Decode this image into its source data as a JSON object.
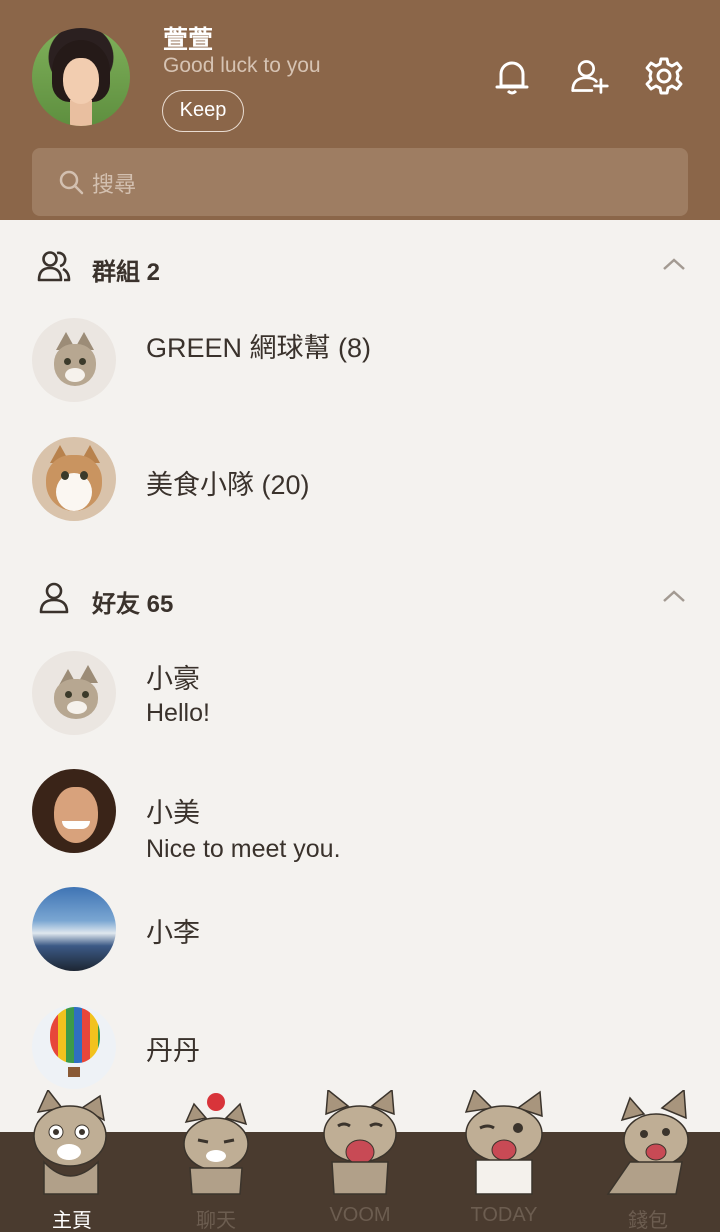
{
  "profile": {
    "name": "萱萱",
    "status": "Good luck to you",
    "keep_label": "Keep"
  },
  "header_icons": [
    "bell-icon",
    "add-friend-icon",
    "gear-icon"
  ],
  "search": {
    "placeholder": "搜尋",
    "icon": "search-icon"
  },
  "groups": {
    "title": "群組 2",
    "icon": "group-icon",
    "items": [
      {
        "name": "GREEN 網球幫 (8)"
      },
      {
        "name": "美食小隊 (20)"
      }
    ]
  },
  "friends": {
    "title": "好友 65",
    "icon": "person-icon",
    "items": [
      {
        "name": "小豪",
        "message": "Hello!"
      },
      {
        "name": "小美",
        "message": "Nice to meet you."
      },
      {
        "name": "小李"
      },
      {
        "name": "丹丹"
      }
    ]
  },
  "nav": {
    "items": [
      {
        "label": "主頁"
      },
      {
        "label": "聊天"
      },
      {
        "label": "VOOM"
      },
      {
        "label": "TODAY"
      },
      {
        "label": "錢包"
      }
    ],
    "active_index": 0
  },
  "colors": {
    "header_bg": "#8b6649",
    "search_bg": "#9e7d62",
    "page_bg": "#f4f2ef",
    "nav_bg": "#4a3b2f",
    "text": "#3a322c"
  }
}
